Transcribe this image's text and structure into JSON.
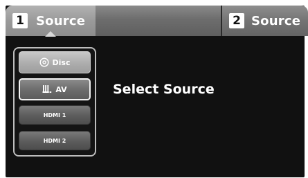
{
  "tabs": [
    {
      "number": "1",
      "label": "Source"
    },
    {
      "number": "2",
      "label": "Source"
    }
  ],
  "sources": {
    "disc": {
      "label": "Disc",
      "icon": "disc-icon"
    },
    "av": {
      "label": "AV",
      "icon": "av-input-icon"
    },
    "hdmi1": {
      "label": "HDMI 1"
    },
    "hdmi2": {
      "label": "HDMI 2"
    }
  },
  "main": {
    "title": "Select Source"
  }
}
